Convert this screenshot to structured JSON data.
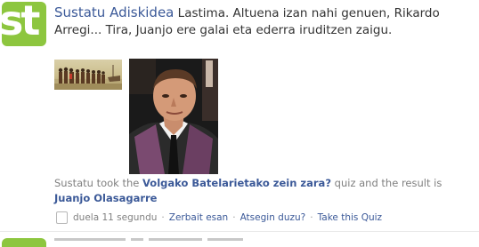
{
  "story": {
    "avatar_text": "st",
    "actor": "Sustatu Adiskidea",
    "message": "Lastima. Altuena izan nahi genuen, Rikardo Arregi... Tira, Juanjo ere galai eta ederra iruditzen zaigu.",
    "attachment": {
      "prefix": "Sustatu took the",
      "quiz_title": "Volgako Batelarietako zein zara?",
      "middle": "quiz and the result is",
      "result": "Juanjo Olasagarre"
    },
    "footer": {
      "time": "duela 11 segundu",
      "separator": "·",
      "comment": "Zerbait esan",
      "like": "Atsegin duzu?",
      "take_quiz": "Take this Quiz"
    }
  },
  "colors": {
    "link": "#3b5998",
    "avatar_bg": "#8dc63f",
    "meta_text": "#808080"
  }
}
